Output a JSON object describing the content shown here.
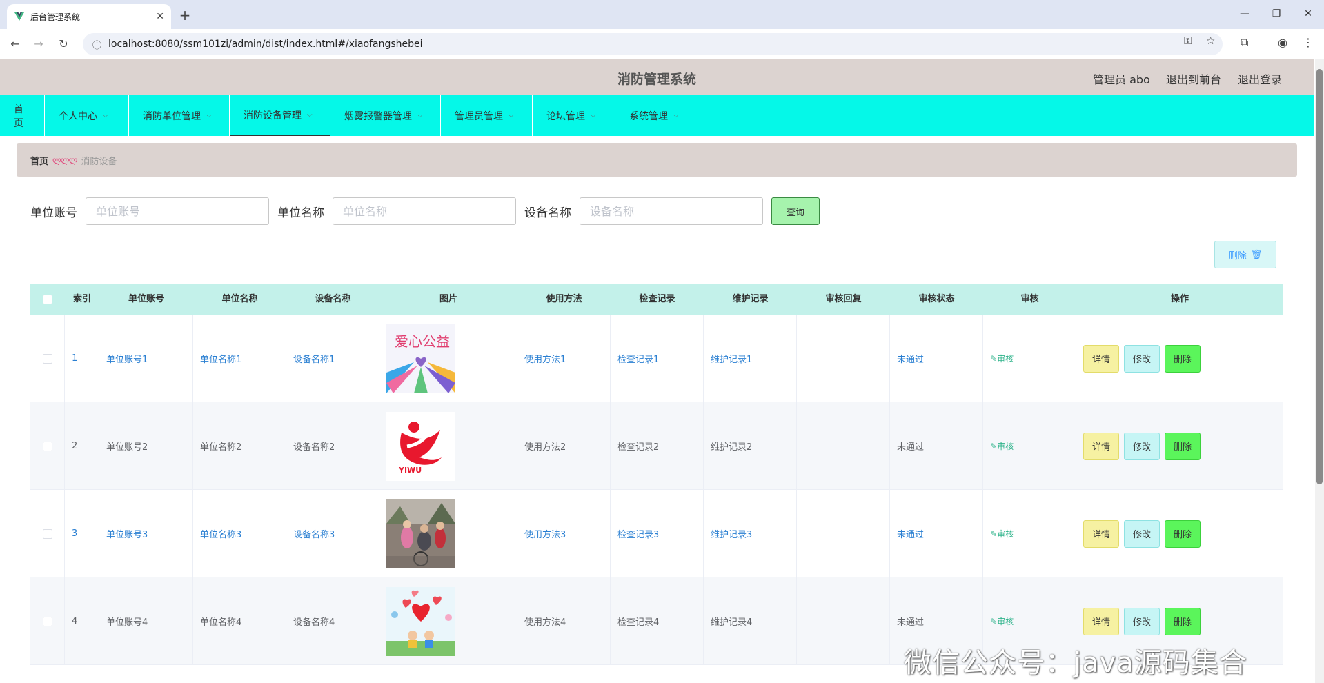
{
  "browser": {
    "tab_title": "后台管理系统",
    "url": "localhost:8080/ssm101zi/admin/dist/index.html#/xiaofangshebei"
  },
  "header": {
    "title": "消防管理系统",
    "admin": "管理员 abo",
    "to_front": "退出到前台",
    "logout": "退出登录"
  },
  "nav": {
    "items": [
      "首页",
      "个人中心",
      "消防单位管理",
      "消防设备管理",
      "烟雾报警器管理",
      "管理员管理",
      "论坛管理",
      "系统管理"
    ],
    "active": "消防设备管理"
  },
  "breadcrumb": {
    "home": "首页",
    "current": "消防设备"
  },
  "search": {
    "label1": "单位账号",
    "placeholder1": "单位账号",
    "label2": "单位名称",
    "placeholder2": "单位名称",
    "label3": "设备名称",
    "placeholder3": "设备名称",
    "query": "查询"
  },
  "toolbar": {
    "delete": "删除"
  },
  "table": {
    "headers": [
      "索引",
      "单位账号",
      "单位名称",
      "设备名称",
      "图片",
      "使用方法",
      "检查记录",
      "维护记录",
      "审核回复",
      "审核状态",
      "审核",
      "操作"
    ],
    "rows": [
      {
        "index": "1",
        "account": "单位账号1",
        "name": "单位名称1",
        "device": "设备名称1",
        "method": "使用方法1",
        "check": "检查记录1",
        "maint": "维护记录1",
        "reply": "",
        "status": "未通过",
        "audit": "审核",
        "image": "charity-poster"
      },
      {
        "index": "2",
        "account": "单位账号2",
        "name": "单位名称2",
        "device": "设备名称2",
        "method": "使用方法2",
        "check": "检查记录2",
        "maint": "维护记录2",
        "reply": "",
        "status": "未通过",
        "audit": "审核",
        "image": "yiwu-logo"
      },
      {
        "index": "3",
        "account": "单位账号3",
        "name": "单位名称3",
        "device": "设备名称3",
        "method": "使用方法3",
        "check": "检查记录3",
        "maint": "维护记录3",
        "reply": "",
        "status": "未通过",
        "audit": "审核",
        "image": "street-photo"
      },
      {
        "index": "4",
        "account": "单位账号4",
        "name": "单位名称4",
        "device": "设备名称4",
        "method": "使用方法4",
        "check": "检查记录4",
        "maint": "维护记录4",
        "reply": "",
        "status": "未通过",
        "audit": "审核",
        "image": "hearts-illustration"
      }
    ],
    "actions": {
      "detail": "详情",
      "edit": "修改",
      "delete": "删除"
    }
  },
  "watermark": "微信公众号：java源码集合",
  "colors": {
    "nav_bg": "#05f8e8",
    "header_bg": "#dcd3d0",
    "table_head": "#c3f1ea",
    "link_blue": "#2a7fd2"
  }
}
